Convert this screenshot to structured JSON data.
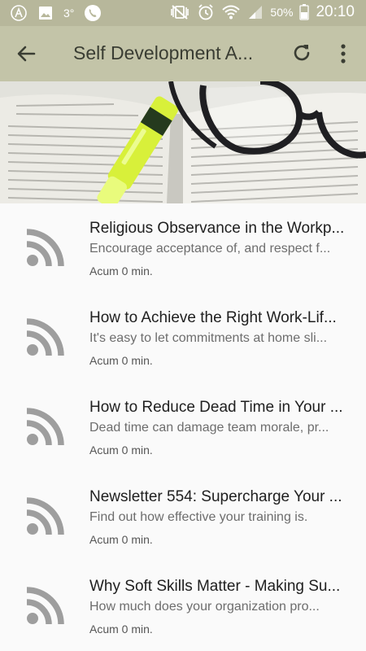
{
  "status_bar": {
    "notification_count": "3°",
    "battery_percent": "50%",
    "time": "20:10"
  },
  "app_bar": {
    "title": "Self Development A..."
  },
  "colors": {
    "status_bar": "#b7b79b",
    "app_bar": "#c3c4a8",
    "rss_icon": "#9e9e9e"
  },
  "feed": {
    "items": [
      {
        "title": "Religious Observance in the Workp...",
        "description": "Encourage acceptance of, and respect f...",
        "meta": "Acum 0 min."
      },
      {
        "title": "How to Achieve the Right Work-Lif...",
        "description": "It's easy to let commitments at home sli...",
        "meta": "Acum 0 min."
      },
      {
        "title": "How to Reduce Dead Time in Your ...",
        "description": "Dead time can damage team morale, pr...",
        "meta": "Acum 0 min."
      },
      {
        "title": "Newsletter 554: Supercharge Your ...",
        "description": "Find out how effective your training is.",
        "meta": "Acum 0 min."
      },
      {
        "title": "Why Soft Skills Matter - Making Su...",
        "description": "How much does your organization pro...",
        "meta": "Acum 0 min."
      }
    ]
  }
}
